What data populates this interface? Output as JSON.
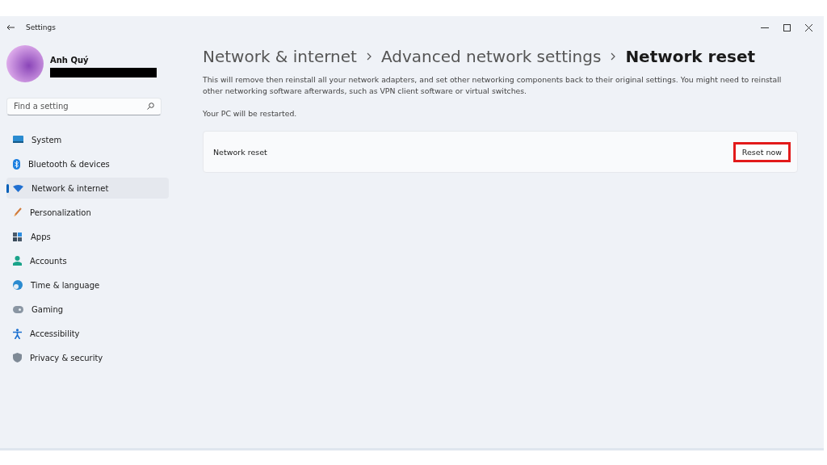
{
  "window": {
    "title": "Settings"
  },
  "user": {
    "name": "Anh Quý"
  },
  "search": {
    "placeholder": "Find a setting"
  },
  "nav": [
    {
      "label": "System",
      "selected": false
    },
    {
      "label": "Bluetooth & devices",
      "selected": false
    },
    {
      "label": "Network & internet",
      "selected": true
    },
    {
      "label": "Personalization",
      "selected": false
    },
    {
      "label": "Apps",
      "selected": false
    },
    {
      "label": "Accounts",
      "selected": false
    },
    {
      "label": "Time & language",
      "selected": false
    },
    {
      "label": "Gaming",
      "selected": false
    },
    {
      "label": "Accessibility",
      "selected": false
    },
    {
      "label": "Privacy & security",
      "selected": false
    }
  ],
  "breadcrumb": [
    "Network & internet",
    "Advanced network settings",
    "Network reset"
  ],
  "description": "This will remove then reinstall all your network adapters, and set other networking components back to their original settings. You might need to reinstall other networking software afterwards, such as VPN client software or virtual switches.",
  "note": "Your PC will be restarted.",
  "card": {
    "label": "Network reset",
    "button": "Reset now",
    "highlighted": true
  }
}
